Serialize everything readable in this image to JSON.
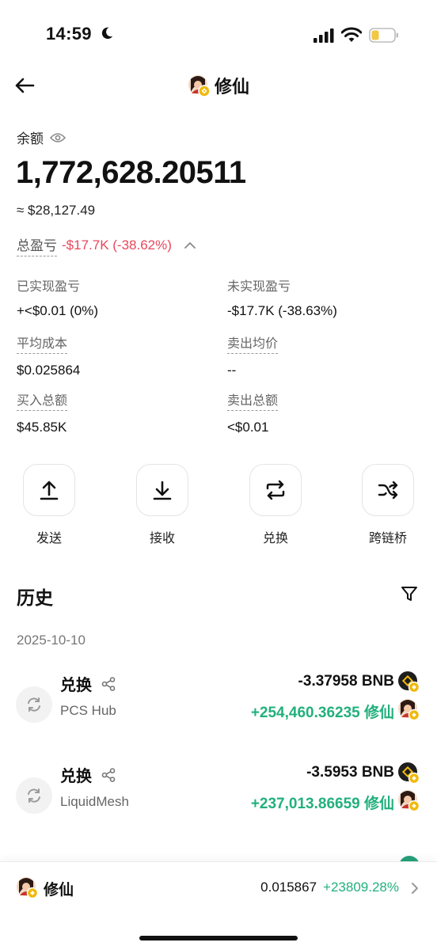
{
  "status_bar": {
    "time": "14:59"
  },
  "header": {
    "title": "修仙"
  },
  "balance": {
    "label": "余额",
    "amount": "1,772,628.20511",
    "usd": "≈ $28,127.49"
  },
  "pnl": {
    "label": "总盈亏",
    "value": "-$17.7K (-38.62%)"
  },
  "stats": {
    "realized_label": "已实现盈亏",
    "realized_value": "+<$0.01 (0%)",
    "unrealized_label": "未实现盈亏",
    "unrealized_value": "-$17.7K (-38.63%)",
    "avg_cost_label": "平均成本",
    "avg_cost_value": "$0.025864",
    "avg_sell_label": "卖出均价",
    "avg_sell_value": "--",
    "total_buy_label": "买入总额",
    "total_buy_value": "$45.85K",
    "total_sell_label": "卖出总额",
    "total_sell_value": "<$0.01"
  },
  "actions": {
    "send": "发送",
    "receive": "接收",
    "swap": "兑换",
    "bridge": "跨链桥"
  },
  "history": {
    "title": "历史",
    "date": "2025-10-10",
    "items": [
      {
        "type": "兑换",
        "source": "PCS Hub",
        "out_amount": "-3.37958 BNB",
        "in_amount": "+254,460.36235 修仙"
      },
      {
        "type": "兑换",
        "source": "LiquidMesh",
        "out_amount": "-3.5953 BNB",
        "in_amount": "+237,013.86659 修仙"
      }
    ]
  },
  "bottom_bar": {
    "name": "修仙",
    "price": "0.015867",
    "change": "+23809.28%"
  },
  "colors": {
    "negative": "#e8465c",
    "positive": "#22b07d"
  },
  "icons": {
    "back": "arrow-left-icon",
    "eye": "eye-icon",
    "send": "upload-arrow-icon",
    "receive": "download-arrow-icon",
    "swap": "swap-arrows-icon",
    "bridge": "shuffle-icon",
    "filter": "funnel-icon",
    "share": "share-icon"
  }
}
